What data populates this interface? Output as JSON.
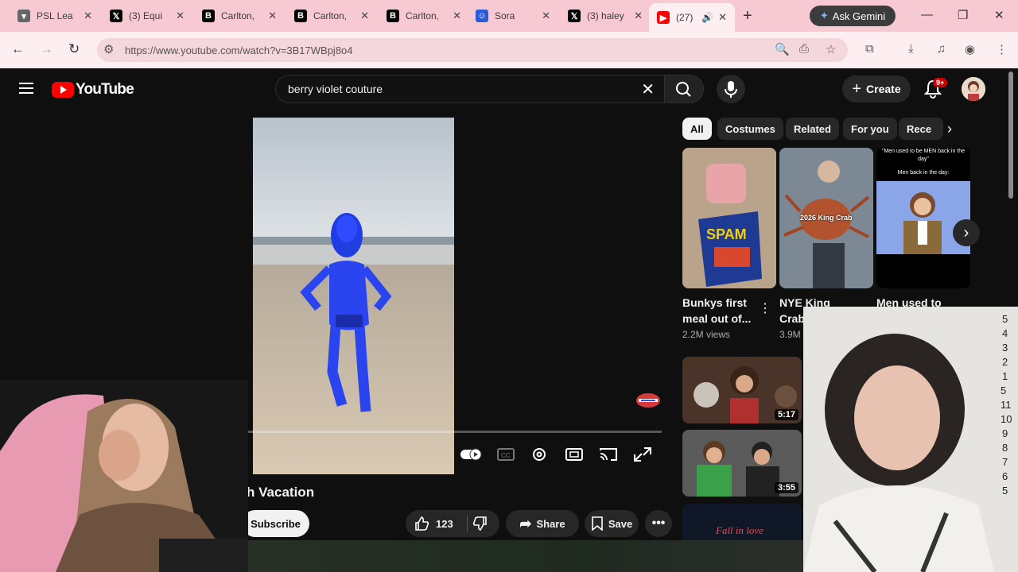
{
  "browser": {
    "tabs": [
      {
        "title": "PSL Lea",
        "favicon": "shield-icon",
        "color": "#555"
      },
      {
        "title": "(3) Equi",
        "favicon": "x-logo-icon",
        "color": "#000"
      },
      {
        "title": "Carlton,",
        "favicon": "b-logo-icon",
        "color": "#000"
      },
      {
        "title": "Carlton,",
        "favicon": "b-logo-icon",
        "color": "#000"
      },
      {
        "title": "Carlton,",
        "favicon": "b-logo-icon",
        "color": "#000"
      },
      {
        "title": "Sora",
        "favicon": "sora-icon",
        "color": "#2a5bd7"
      },
      {
        "title": "(3) haley",
        "favicon": "x-logo-icon",
        "color": "#000"
      },
      {
        "title": "(27)",
        "favicon": "youtube-icon",
        "color": "#ff0000"
      }
    ],
    "gemini_label": "Ask Gemini",
    "url": "https://www.youtube.com/watch?v=3B17WBpj8o4"
  },
  "youtube": {
    "logo_text": "YouTube",
    "search_query": "berry violet couture",
    "create_label": "Create",
    "notif_badge": "9+",
    "video_title": "rry Beach Vacation",
    "subscribe_label": "Subscribe",
    "like_count": "123",
    "share_label": "Share",
    "save_label": "Save",
    "chips": [
      "All",
      "Costumes",
      "Related",
      "For you",
      "Rece"
    ],
    "shorts": [
      {
        "title_line1": "Bunkys first",
        "title_line2": "meal out of...",
        "views": "2.2M views",
        "overlay": ""
      },
      {
        "title_line1": "NYE King",
        "title_line2": "Crab",
        "views": "3.9M",
        "overlay": "2026 King Crab"
      },
      {
        "title_line1": "Men used to",
        "title_line2": "",
        "views": "",
        "overlay": "\"Men used to be MEN back in the day\"",
        "overlay2": "Men back in the day:"
      }
    ],
    "thumbs": [
      {
        "duration": "5:17"
      },
      {
        "duration": "3:55"
      }
    ],
    "bottom_thumb_text": "Fall in love"
  },
  "colors": {
    "accent": "#ff0000",
    "bg": "#0f0f0f",
    "tabstrip": "#f6c9d3"
  }
}
